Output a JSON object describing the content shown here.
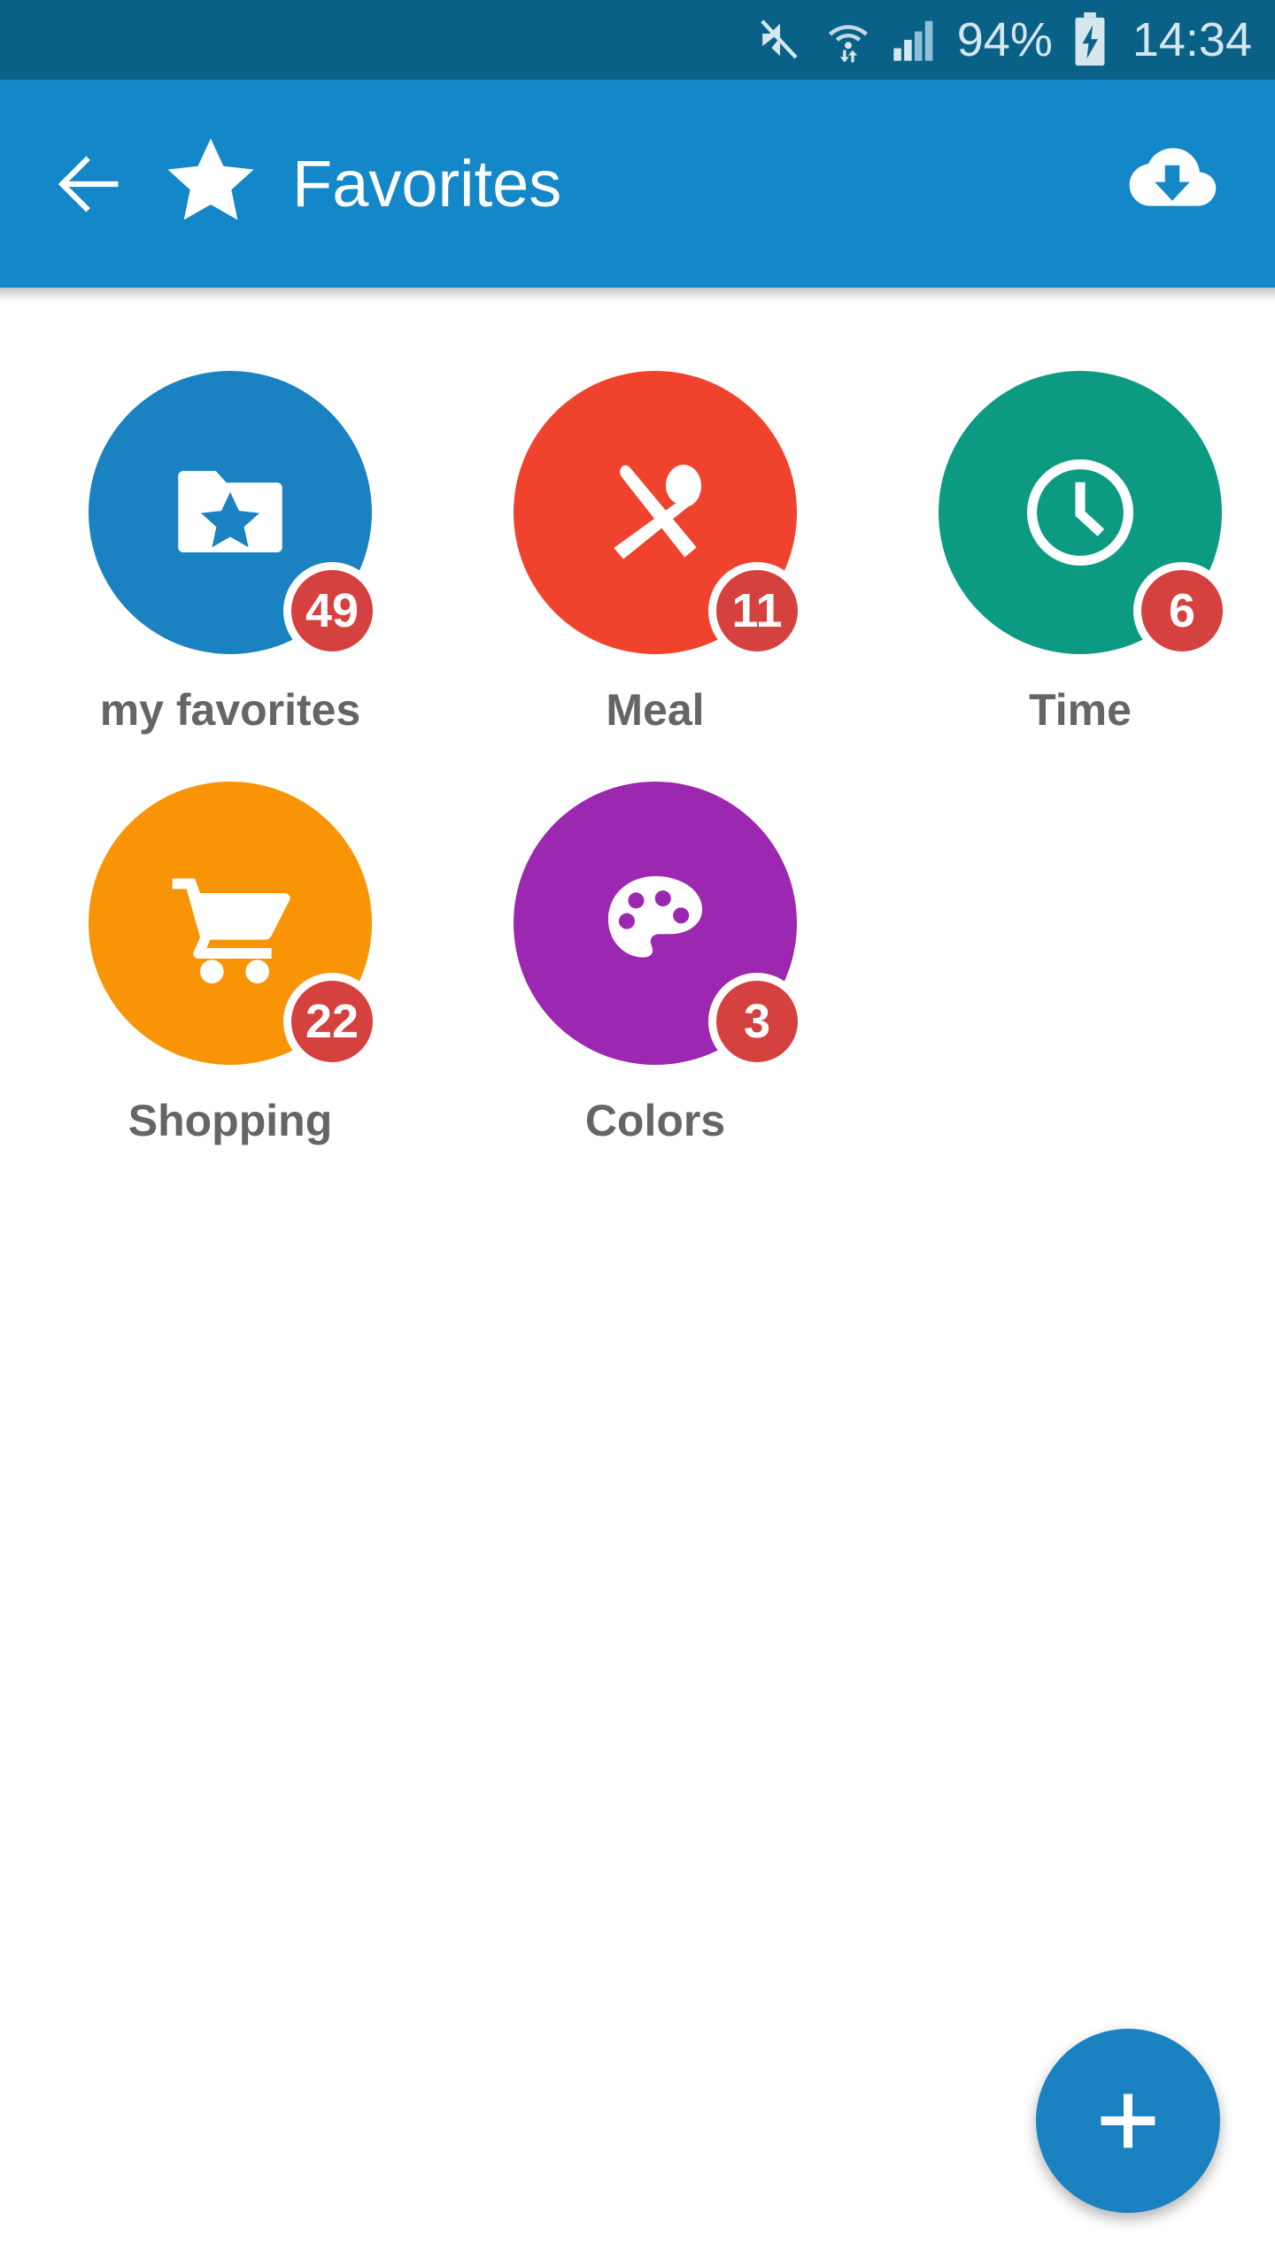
{
  "status_bar": {
    "battery_percent": "94%",
    "time": "14:34",
    "icons": [
      "mute-icon",
      "wifi-icon",
      "signal-icon",
      "battery-charging-icon"
    ],
    "background_color": "#0a6188",
    "text_color": "#d5e6ef"
  },
  "app_bar": {
    "back_label": "back-arrow",
    "brand_icon": "star-icon",
    "title": "Favorites",
    "action_icon": "cloud-download-icon",
    "background_color": "#1387c8"
  },
  "categories": [
    {
      "label": "my favorites",
      "count": "49",
      "color": "#1a82c0",
      "icon": "folder-star-icon"
    },
    {
      "label": "Meal",
      "count": "11",
      "color": "#f0432e",
      "icon": "fork-spoon-icon"
    },
    {
      "label": "Time",
      "count": "6",
      "color": "#0d9a82",
      "icon": "clock-icon"
    },
    {
      "label": "Shopping",
      "count": "22",
      "color": "#f89406",
      "icon": "shopping-cart-icon"
    },
    {
      "label": "Colors",
      "count": "3",
      "color": "#9c27b0",
      "icon": "palette-icon"
    }
  ],
  "badge": {
    "color": "#d5413f",
    "text_color": "#ffffff"
  },
  "fab": {
    "icon": "plus-icon",
    "color": "#1a82c0"
  }
}
